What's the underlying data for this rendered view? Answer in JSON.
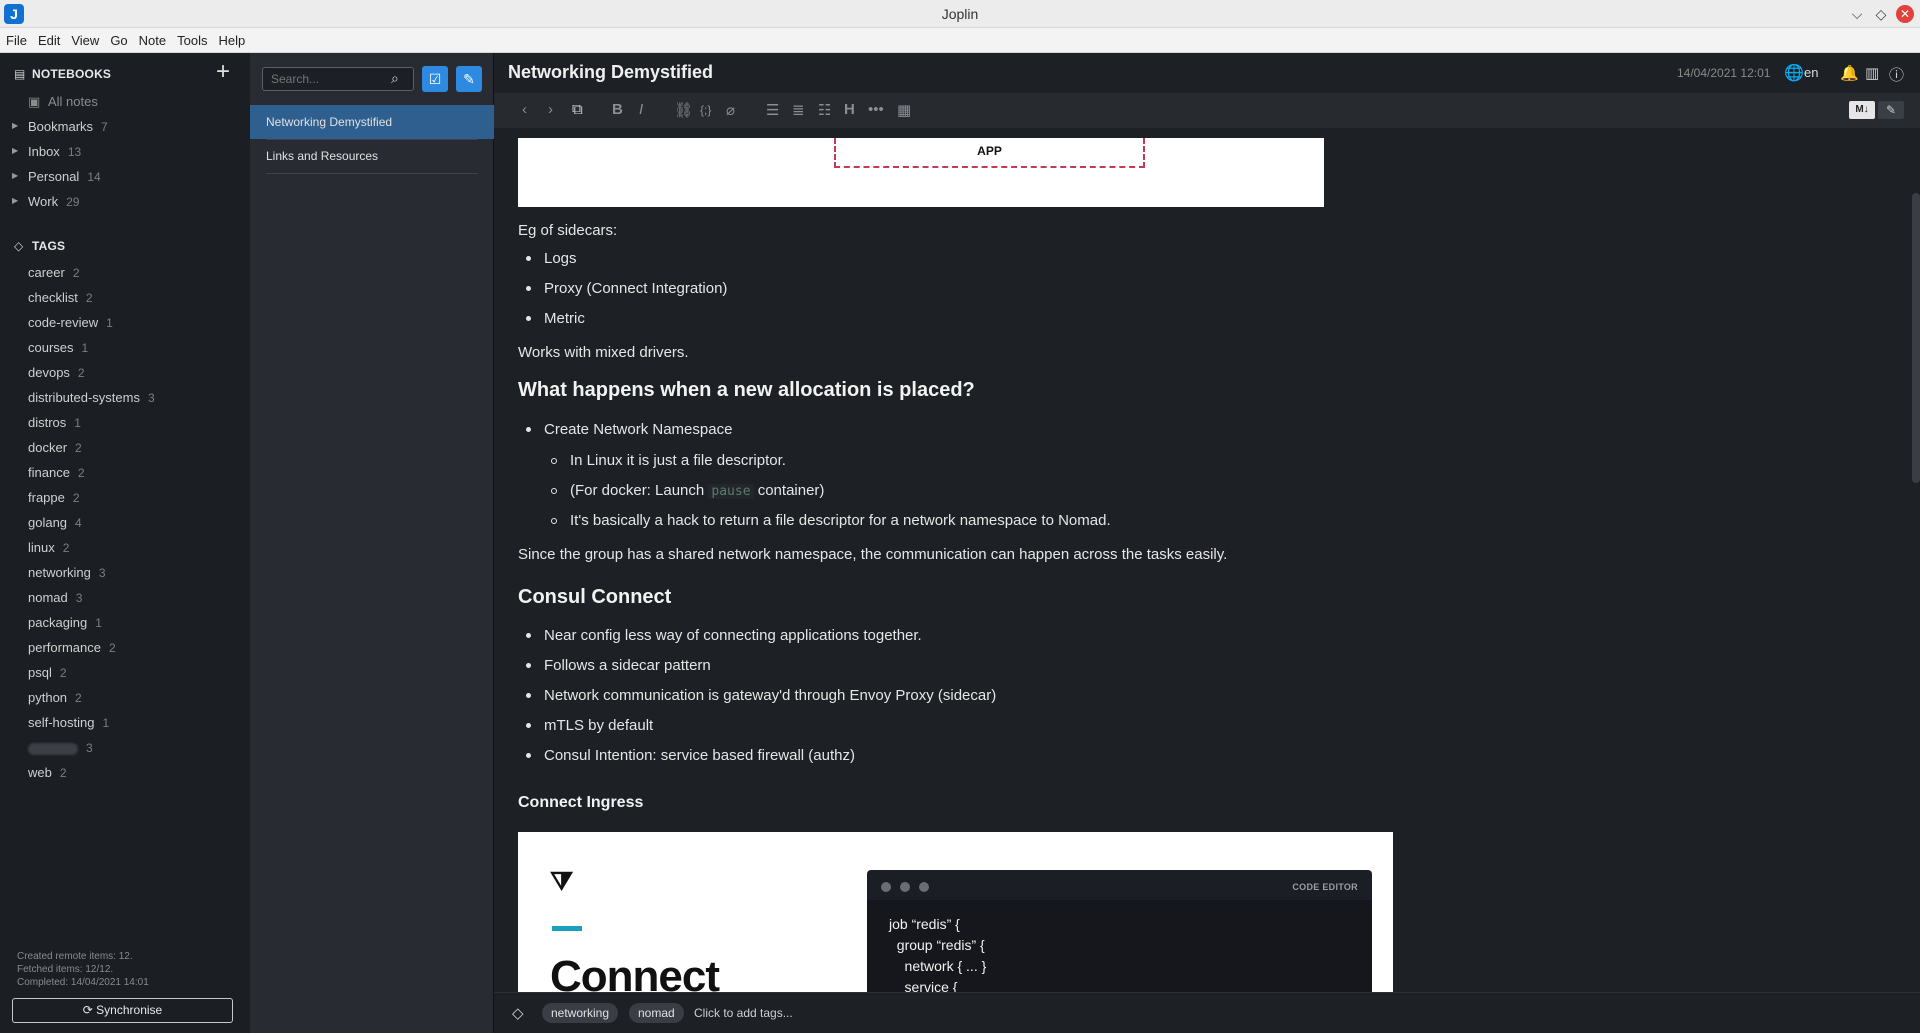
{
  "window": {
    "title": "Joplin",
    "logo": "J",
    "minimize_glyph": "⌵",
    "maximize_glyph": "◇",
    "close_glyph": "✕"
  },
  "menu": [
    "File",
    "Edit",
    "View",
    "Go",
    "Note",
    "Tools",
    "Help"
  ],
  "sidebar": {
    "notebooks_header": "NOTEBOOKS",
    "all_notes": "All notes",
    "notebooks": [
      {
        "label": "Bookmarks",
        "count": "7"
      },
      {
        "label": "Inbox",
        "count": "13"
      },
      {
        "label": "Personal",
        "count": "14"
      },
      {
        "label": "Work",
        "count": "29"
      }
    ],
    "tags_header": "TAGS",
    "tags": [
      {
        "label": "career",
        "count": "2"
      },
      {
        "label": "checklist",
        "count": "2"
      },
      {
        "label": "code-review",
        "count": "1"
      },
      {
        "label": "courses",
        "count": "1"
      },
      {
        "label": "devops",
        "count": "2"
      },
      {
        "label": "distributed-systems",
        "count": "3"
      },
      {
        "label": "distros",
        "count": "1"
      },
      {
        "label": "docker",
        "count": "2"
      },
      {
        "label": "finance",
        "count": "2"
      },
      {
        "label": "frappe",
        "count": "2"
      },
      {
        "label": "golang",
        "count": "4"
      },
      {
        "label": "linux",
        "count": "2"
      },
      {
        "label": "networking",
        "count": "3"
      },
      {
        "label": "nomad",
        "count": "3"
      },
      {
        "label": "packaging",
        "count": "1"
      },
      {
        "label": "performance",
        "count": "2"
      },
      {
        "label": "psql",
        "count": "2"
      },
      {
        "label": "python",
        "count": "2"
      },
      {
        "label": "self-hosting",
        "count": "1"
      },
      {
        "label": "",
        "count": "3",
        "blurred": true
      },
      {
        "label": "web",
        "count": "2"
      }
    ],
    "sync_stats": [
      "Created remote items: 12.",
      "Fetched items: 12/12.",
      "Completed: 14/04/2021 14:01"
    ],
    "sync_button": "Synchronise"
  },
  "notelist": {
    "search_placeholder": "Search...",
    "notes": [
      {
        "title": "Networking Demystified",
        "selected": true
      },
      {
        "title": "Links and Resources",
        "selected": false
      }
    ]
  },
  "editor": {
    "title": "Networking Demystified",
    "date": "14/04/2021 12:01",
    "language": "en",
    "mode_markdown_label": "M↓",
    "toolbar_icons": [
      "back-icon",
      "forward-icon",
      "external-edit-icon",
      "bold-icon",
      "italic-icon",
      "link-icon",
      "code-icon",
      "attachment-icon",
      "bullet-list-icon",
      "numbered-list-icon",
      "checkbox-list-icon",
      "heading-icon",
      "horizontal-rule-icon",
      "insert-time-icon"
    ]
  },
  "content": {
    "app_label": "APP",
    "sidecars_intro": "Eg of sidecars:",
    "sidecars": [
      "Logs",
      "Proxy (Connect Integration)",
      "Metric"
    ],
    "mixed_drivers": "Works with mixed drivers.",
    "h_allocation": "What happens when a new allocation is placed?",
    "create_ns": "Create Network Namespace",
    "ns_sub1": "In Linux it is just a file descriptor.",
    "ns_sub2_before": "(For docker: Launch ",
    "ns_sub2_code": "pause",
    "ns_sub2_after": " container)",
    "ns_sub3": "It's basically a hack to return a file descriptor for a network namespace to Nomad.",
    "shared_ns": "Since the group has a shared network namespace, the communication can happen across the tasks easily.",
    "h_consul": "Consul Connect",
    "consul_points": [
      "Near config less way of connecting applications together.",
      "Follows a sidecar pattern",
      "Network communication is gateway'd through Envoy Proxy (sidecar)",
      "mTLS by default",
      "Consul Intention: service based firewall (authz)"
    ],
    "h_ingress": "Connect Ingress",
    "slide_title": "Connect",
    "code_editor_label": "CODE EDITOR",
    "code_lines": [
      "job “redis” {",
      "  group “redis” {",
      "    network { ... }",
      "    service {"
    ]
  },
  "tagbar": {
    "tags": [
      "networking",
      "nomad"
    ],
    "add_tags": "Click to add tags..."
  }
}
